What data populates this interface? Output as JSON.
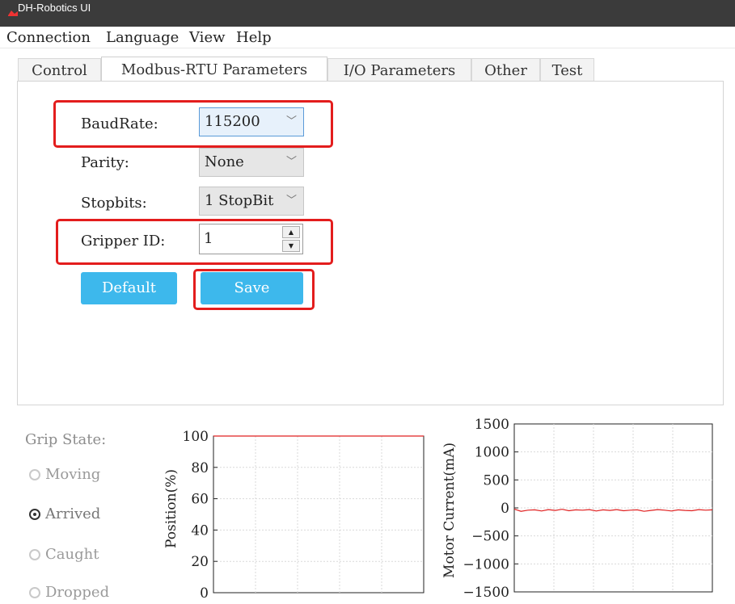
{
  "window": {
    "title": "DH-Robotics UI"
  },
  "menu": [
    "Connection",
    "Language",
    "View",
    "Help"
  ],
  "tabs": [
    {
      "label": "Control",
      "active": false
    },
    {
      "label": "Modbus-RTU Parameters",
      "active": true
    },
    {
      "label": "I/O Parameters",
      "active": false
    },
    {
      "label": "Other",
      "active": false
    },
    {
      "label": "Test",
      "active": false
    }
  ],
  "params": {
    "baudrate": {
      "label": "BaudRate:",
      "value": "115200"
    },
    "parity": {
      "label": "Parity:",
      "value": "None"
    },
    "stopbits": {
      "label": "Stopbits:",
      "value": "1 StopBit"
    },
    "gripper_id": {
      "label": "Gripper ID:",
      "value": "1"
    }
  },
  "buttons": {
    "default": "Default",
    "save": "Save"
  },
  "grip_state": {
    "title": "Grip State:",
    "options": [
      {
        "label": "Moving",
        "checked": false
      },
      {
        "label": "Arrived",
        "checked": true
      },
      {
        "label": "Caught",
        "checked": false
      },
      {
        "label": "Dropped",
        "checked": false
      }
    ]
  },
  "colors": {
    "accent": "#3db8ec",
    "highlight": "#e31d1d",
    "trace": "#e02020",
    "titlebar": "#3b3b3b"
  },
  "chart_data": [
    {
      "type": "line",
      "ylabel": "Position(%)",
      "yticks": [
        0,
        20,
        40,
        60,
        80,
        100
      ],
      "ylim": [
        0,
        100
      ],
      "grid": true,
      "series": [
        {
          "values": [
            100,
            100,
            100,
            100,
            100,
            100,
            100,
            100,
            100,
            100,
            100
          ]
        }
      ]
    },
    {
      "type": "line",
      "ylabel": "Motor Current(mA)",
      "yticks": [
        -1500,
        -1000,
        -500,
        0,
        500,
        1000,
        1500
      ],
      "ylim": [
        -1500,
        1500
      ],
      "grid": true,
      "series": [
        {
          "values": [
            -20,
            -60,
            -40,
            -35,
            -55,
            -30,
            -45,
            -25,
            -50,
            -35,
            -40,
            -30,
            -55,
            -35,
            -45,
            -30,
            -50,
            -40,
            -35,
            -60,
            -45,
            -30,
            -40,
            -55,
            -35,
            -45,
            -50,
            -30,
            -40,
            -35
          ]
        }
      ]
    }
  ]
}
